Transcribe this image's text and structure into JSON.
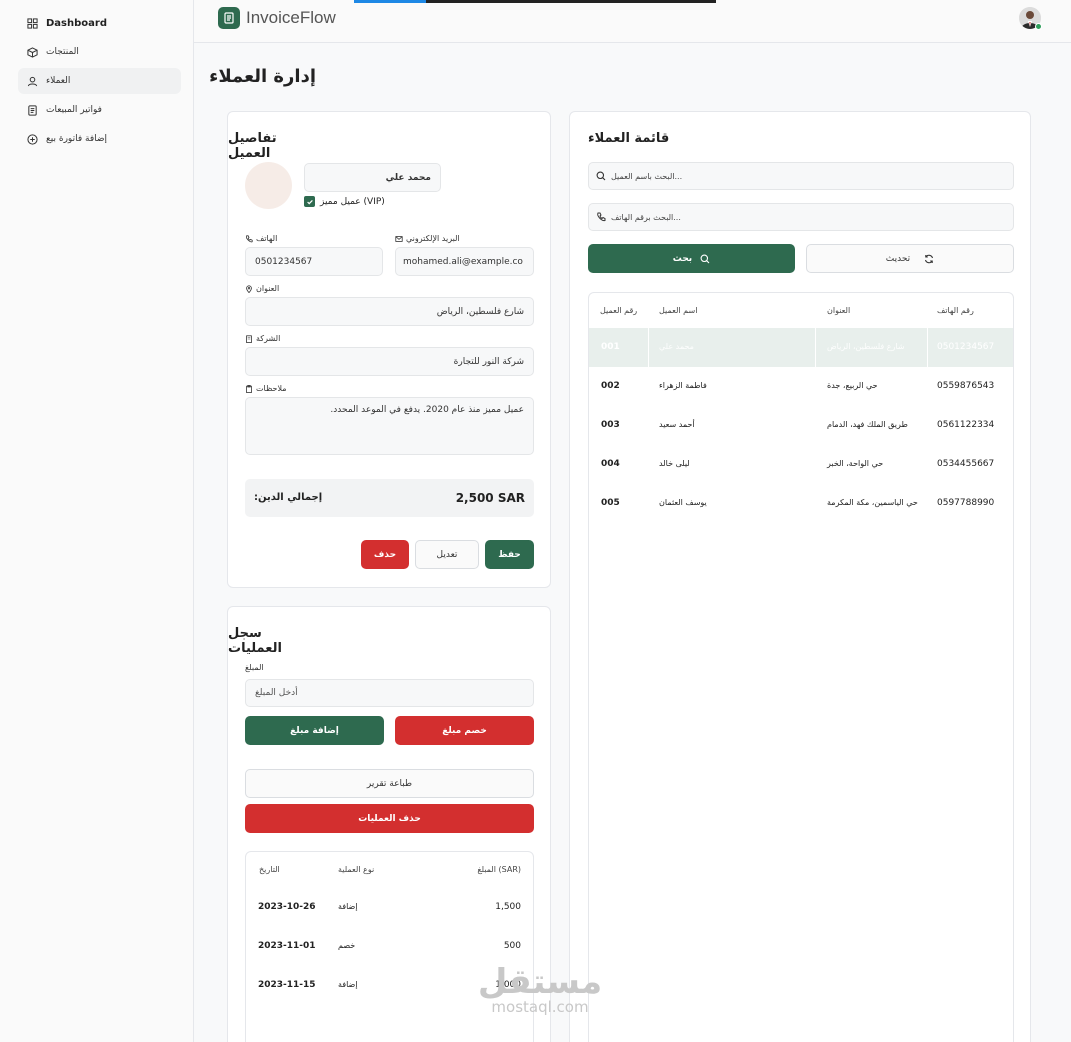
{
  "sidebar": {
    "items": [
      {
        "label": "Dashboard",
        "icon": "grid-icon"
      },
      {
        "label": "المنتجات",
        "icon": "box-icon"
      },
      {
        "label": "العملاء",
        "icon": "user-icon"
      },
      {
        "label": "فواتير المبيعات",
        "icon": "document-icon"
      },
      {
        "label": "إضافة فاتورة بيع",
        "icon": "plus-circle-icon"
      }
    ],
    "active_index": 2
  },
  "topbar": {
    "brand": "InvoiceFlow",
    "brand_color": "#2e6a4f",
    "status_color": "#2e9e5b",
    "page_load_progress": 0.2
  },
  "page": {
    "title": "إدارة العملاء"
  },
  "details": {
    "title": "تفاصيل العميل",
    "name": "محمد علي",
    "vip_label": "عميل مميز (VIP)",
    "vip_checked": true,
    "phone_label": "الهاتف",
    "phone": "0501234567",
    "email_label": "البريد الإلكتروني",
    "email": "mohamed.ali@example.co",
    "address_label": "العنوان",
    "address": "شارع فلسطين، الرياض",
    "company_label": "الشركة",
    "company": "شركة النور للتجارة",
    "notes_label": "ملاحظات",
    "notes": "عميل مميز منذ عام 2020. يدفع في الموعد المحدد.",
    "debt_label": "إجمالي الدين:",
    "debt_value": "2,500 SAR",
    "save_label": "حفظ",
    "edit_label": "تعديل",
    "delete_label": "حذف"
  },
  "ops": {
    "title": "سجل العمليات",
    "amount_label": "المبلغ",
    "amount_placeholder": "أدخل المبلغ",
    "add_label": "إضافة مبلغ",
    "deduct_label": "خصم مبلغ",
    "print_label": "طباعة تقرير",
    "delete_label": "حذف العمليات",
    "headers": {
      "date": "التاريخ",
      "type": "نوع العملية",
      "amount": "المبلغ (SAR)"
    },
    "rows": [
      {
        "date": "2023-10-26",
        "type": "إضافة",
        "amount": "1,500"
      },
      {
        "date": "2023-11-01",
        "type": "خصم",
        "amount": "500"
      },
      {
        "date": "2023-11-15",
        "type": "إضافة",
        "amount": "1,000"
      }
    ]
  },
  "list": {
    "title": "قائمة العملاء",
    "search_name_placeholder": "البحث باسم العميل...",
    "search_phone_placeholder": "البحث برقم الهاتف...",
    "search_label": "بحث",
    "refresh_label": "تحديث",
    "headers": {
      "id": "رقم العميل",
      "name": "اسم العميل",
      "address": "العنوان",
      "phone": "رقم الهاتف"
    },
    "selected_index": 0,
    "rows": [
      {
        "id": "001",
        "name": "محمد علي",
        "address": "شارع فلسطين، الرياض",
        "phone": "0501234567"
      },
      {
        "id": "002",
        "name": "فاطمة الزهراء",
        "address": "حي الربيع، جدة",
        "phone": "0559876543"
      },
      {
        "id": "003",
        "name": "أحمد سعيد",
        "address": "طريق الملك فهد، الدمام",
        "phone": "0561122334"
      },
      {
        "id": "004",
        "name": "ليلى خالد",
        "address": "حي الواحة، الخبر",
        "phone": "0534455667"
      },
      {
        "id": "005",
        "name": "يوسف العثمان",
        "address": "حي الياسمين، مكة المكرمة",
        "phone": "0597788990"
      }
    ]
  },
  "watermark": {
    "arabic": "مستقل",
    "latin": "mostaql.com"
  }
}
